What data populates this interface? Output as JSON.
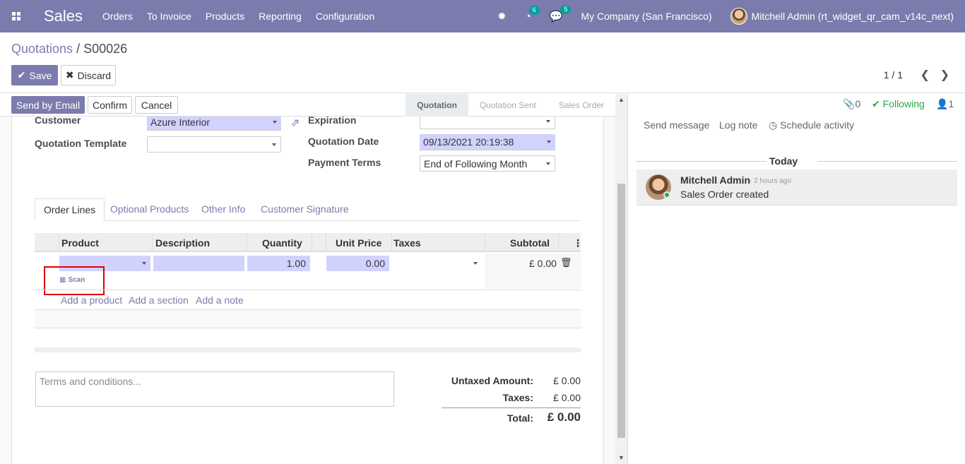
{
  "navbar": {
    "app_name": "Sales",
    "menu": [
      "Orders",
      "To Invoice",
      "Products",
      "Reporting",
      "Configuration"
    ],
    "activity_count": "6",
    "message_count": "5",
    "company": "My Company (San Francisco)",
    "user": "Mitchell Admin (rt_widget_qr_cam_v14c_next)"
  },
  "control": {
    "breadcrumb_parent": "Quotations",
    "breadcrumb_sep": "/",
    "breadcrumb_current": "S00026",
    "save_label": "Save",
    "discard_label": "Discard",
    "pager": "1 / 1"
  },
  "statusbar": {
    "send_email": "Send by Email",
    "confirm": "Confirm",
    "cancel": "Cancel",
    "stages": [
      "Quotation",
      "Quotation Sent",
      "Sales Order"
    ],
    "active_stage": "Quotation"
  },
  "form": {
    "customer_label": "Customer",
    "customer_value": "Azure Interior",
    "template_label": "Quotation Template",
    "template_value": "",
    "expiration_label": "Expiration",
    "expiration_value": "",
    "date_label": "Quotation Date",
    "date_value": "09/13/2021 20:19:38",
    "payment_label": "Payment Terms",
    "payment_value": "End of Following Month"
  },
  "tabs": [
    "Order Lines",
    "Optional Products",
    "Other Info",
    "Customer Signature"
  ],
  "order_lines": {
    "columns": [
      "Product",
      "Description",
      "Quantity",
      "Unit Price",
      "Taxes",
      "Subtotal"
    ],
    "row": {
      "product": "",
      "description": "",
      "quantity": "1.00",
      "unit_price": "0.00",
      "taxes": "",
      "subtotal": "£ 0.00"
    },
    "scan_label": "Scan",
    "add_product": "Add a product",
    "add_section": "Add a section",
    "add_note": "Add a note"
  },
  "terms_placeholder": "Terms and conditions...",
  "totals": {
    "untaxed_label": "Untaxed Amount:",
    "untaxed_value": "£ 0.00",
    "taxes_label": "Taxes:",
    "taxes_value": "£ 0.00",
    "total_label": "Total:",
    "total_value": "£ 0.00"
  },
  "chatter": {
    "attachments": "0",
    "following": "Following",
    "followers": "1",
    "send_message": "Send message",
    "log_note": "Log note",
    "schedule_activity": "Schedule activity",
    "today": "Today",
    "message": {
      "author": "Mitchell Admin",
      "time": "- 2 hours ago",
      "body": "Sales Order created"
    }
  },
  "colors": {
    "brand": "#7c7bad",
    "required_field": "#d2d2ff",
    "following": "#28a745",
    "highlight_box": "#dd0000"
  }
}
